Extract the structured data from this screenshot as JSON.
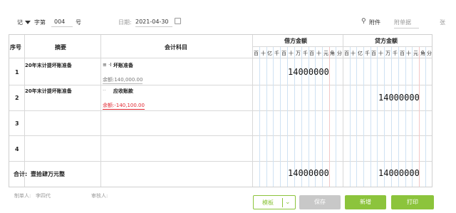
{
  "header": {
    "voucher_type": "记",
    "char_label": "字第",
    "number": "004",
    "number_suffix": "号",
    "date_label": "日期:",
    "date_value": "2021-04-30",
    "attachment_label": "附件",
    "attachment_placeholder": "附单据",
    "attachment_suffix": "张"
  },
  "table": {
    "col_seq": "序号",
    "col_summary": "摘要",
    "col_account": "会计科目",
    "col_debit": "借方金额",
    "col_credit": "贷方金额",
    "digit_headers": [
      "百",
      "十",
      "亿",
      "千",
      "百",
      "十",
      "万",
      "千",
      "百",
      "十",
      "元",
      "角",
      "分"
    ],
    "rows": [
      {
        "seq": "1",
        "summary": "20年末计提坏账准备",
        "account": "坏账准备",
        "account_icon": "≡ ·I",
        "balance": "余额:140,000.00",
        "balance_color": "#777777",
        "debit": "14000000",
        "credit": ""
      },
      {
        "seq": "2",
        "summary": "20年末计提坏账准备",
        "account": "应收账款",
        "account_icon": "··",
        "balance": "余额:-140,100.00",
        "balance_color": "#e0262f",
        "debit": "",
        "credit": "14000000"
      },
      {
        "seq": "3",
        "summary": "",
        "account": "",
        "balance": "",
        "debit": "",
        "credit": ""
      },
      {
        "seq": "4",
        "summary": "",
        "account": "",
        "balance": "",
        "debit": "",
        "credit": ""
      }
    ],
    "total_label": "合计:",
    "total_words": "壹拾肆万元整",
    "total_debit": "14000000",
    "total_credit": "14000000"
  },
  "footer": {
    "maker_label": "制单人:",
    "maker": "李四代",
    "reviewer_label": "审核人:",
    "template_label": "模板",
    "save_label": "保存",
    "add_label": "新增",
    "print_label": "打印"
  },
  "colors": {
    "accent_green": "#8cc43c",
    "save_gray": "#c8c8c8",
    "red": "#e0262f"
  }
}
